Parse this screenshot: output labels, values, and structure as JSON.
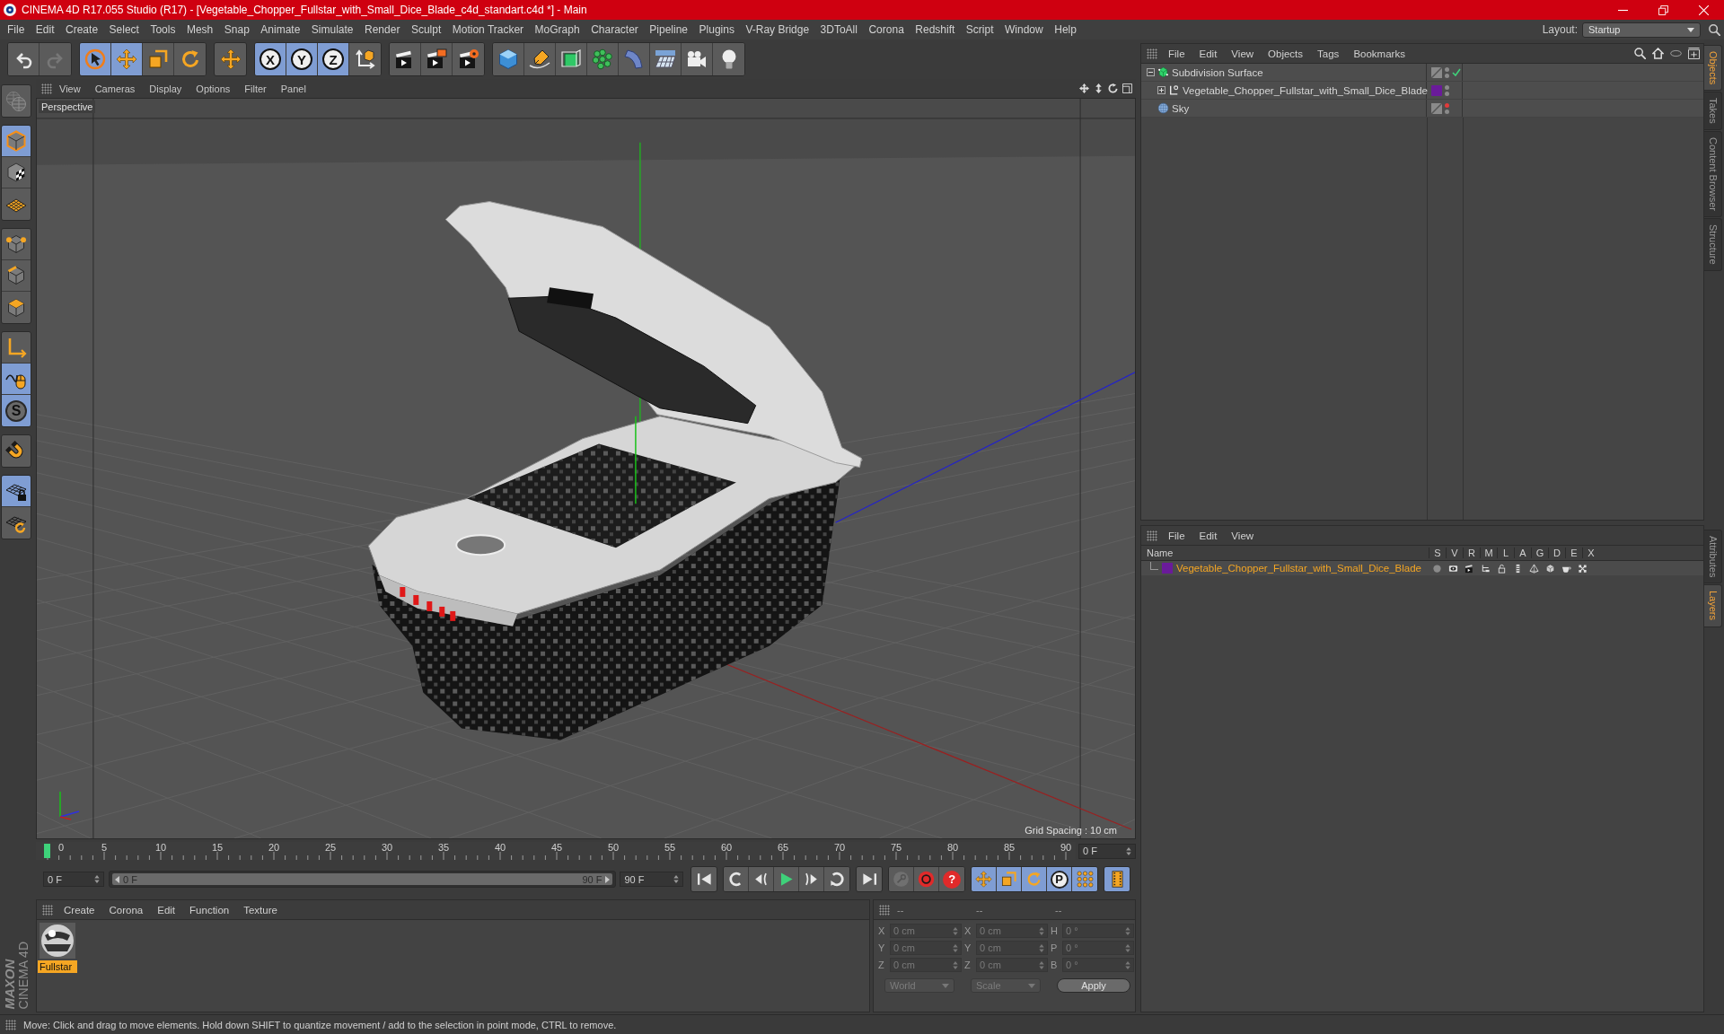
{
  "window": {
    "title": "CINEMA 4D R17.055 Studio (R17) - [Vegetable_Chopper_Fullstar_with_Small_Dice_Blade_c4d_standart.c4d *] - Main"
  },
  "menu_bar": [
    "File",
    "Edit",
    "Create",
    "Select",
    "Tools",
    "Mesh",
    "Snap",
    "Animate",
    "Simulate",
    "Render",
    "Sculpt",
    "Motion Tracker",
    "MoGraph",
    "Character",
    "Pipeline",
    "Plugins",
    "V-Ray Bridge",
    "3DToAll",
    "Corona",
    "Redshift",
    "Script",
    "Window",
    "Help"
  ],
  "layout": {
    "label": "Layout:",
    "value": "Startup"
  },
  "toolbar": [
    [
      {
        "kind": "undo",
        "active": false,
        "disabled": false
      },
      {
        "kind": "redo",
        "active": false,
        "disabled": true
      }
    ],
    [
      {
        "kind": "live-select",
        "active": true,
        "disabled": false
      },
      {
        "kind": "move",
        "active": true,
        "disabled": false
      },
      {
        "kind": "scale",
        "active": false,
        "disabled": false
      },
      {
        "kind": "rotate",
        "active": false,
        "disabled": false
      }
    ],
    [
      {
        "kind": "recent-tool",
        "active": false,
        "disabled": false
      }
    ],
    [
      {
        "kind": "axis-lock",
        "label": "X",
        "active": true,
        "disabled": false
      },
      {
        "kind": "axis-lock",
        "label": "Y",
        "active": true,
        "disabled": false
      },
      {
        "kind": "axis-lock",
        "label": "Z",
        "active": true,
        "disabled": false
      },
      {
        "kind": "coordinate-system",
        "active": false,
        "disabled": false
      }
    ],
    [
      {
        "kind": "render-view",
        "active": false,
        "disabled": false
      },
      {
        "kind": "render-picture",
        "active": false,
        "disabled": false
      },
      {
        "kind": "render-settings",
        "active": false,
        "disabled": false
      }
    ],
    [
      {
        "kind": "cube",
        "active": false,
        "disabled": false
      },
      {
        "kind": "pen",
        "active": false,
        "disabled": false
      },
      {
        "kind": "subdivision",
        "active": false,
        "disabled": false
      },
      {
        "kind": "cloner",
        "active": false,
        "disabled": false
      },
      {
        "kind": "deformer",
        "active": false,
        "disabled": false
      },
      {
        "kind": "floor",
        "active": false,
        "disabled": false
      },
      {
        "kind": "camera",
        "active": false,
        "disabled": false
      },
      {
        "kind": "light",
        "active": false,
        "disabled": false
      }
    ]
  ],
  "left_toolbar": [
    [
      {
        "kind": "make-editable",
        "active": false,
        "disabled": true
      }
    ],
    [
      {
        "kind": "model",
        "active": true,
        "disabled": false
      },
      {
        "kind": "texture",
        "active": false,
        "disabled": false
      },
      {
        "kind": "workplane",
        "active": false,
        "disabled": false
      }
    ],
    [
      {
        "kind": "points",
        "active": false,
        "disabled": false
      },
      {
        "kind": "edges",
        "active": false,
        "disabled": false
      },
      {
        "kind": "polygons",
        "active": false,
        "disabled": false
      }
    ],
    [
      {
        "kind": "axis",
        "active": false,
        "disabled": false
      },
      {
        "kind": "tweak",
        "active": true,
        "disabled": false
      },
      {
        "kind": "snap",
        "label": "S",
        "active": true,
        "disabled": false
      }
    ],
    [
      {
        "kind": "magnet",
        "active": false,
        "disabled": false
      }
    ],
    [
      {
        "kind": "workplane-lock",
        "active": true,
        "disabled": false
      },
      {
        "kind": "workplane-cycle",
        "active": false,
        "disabled": false
      }
    ]
  ],
  "logo": {
    "brand": "MAXON",
    "product": "CINEMA 4D"
  },
  "viewport": {
    "menu": [
      "View",
      "Cameras",
      "Display",
      "Options",
      "Filter",
      "Panel"
    ],
    "camera": "Perspective",
    "grid_spacing": "Grid Spacing : 10 cm"
  },
  "timeline": {
    "ticks": [
      "0",
      "5",
      "10",
      "15",
      "20",
      "25",
      "30",
      "35",
      "40",
      "45",
      "50",
      "55",
      "60",
      "65",
      "70",
      "75",
      "80",
      "85",
      "90"
    ],
    "playhead": {
      "level": 0
    },
    "current_frame": "0 F",
    "start": "0 F",
    "range": {
      "start": "0 F",
      "end": "90 F",
      "level": 1
    },
    "end": "90 F",
    "buttons": [
      [
        {
          "kind": "go-start",
          "active": false,
          "disabled": false
        }
      ],
      [
        {
          "kind": "previous-key",
          "active": false,
          "disabled": false
        },
        {
          "kind": "previous-frame",
          "active": false,
          "disabled": false
        },
        {
          "kind": "play",
          "active": false,
          "disabled": false
        },
        {
          "kind": "next-frame",
          "active": false,
          "disabled": false
        },
        {
          "kind": "next-key",
          "active": false,
          "disabled": false
        }
      ],
      [
        {
          "kind": "go-end",
          "active": false,
          "disabled": false
        }
      ],
      [
        {
          "kind": "keyframe",
          "active": false,
          "disabled": true
        },
        {
          "kind": "record",
          "active": false,
          "disabled": false
        },
        {
          "kind": "autokey",
          "label": "?",
          "active": false,
          "disabled": false
        }
      ],
      [
        {
          "kind": "key-position",
          "active": true,
          "disabled": false
        },
        {
          "kind": "key-scale",
          "active": true,
          "disabled": false
        },
        {
          "kind": "key-rotation",
          "active": true,
          "disabled": false
        },
        {
          "kind": "key-parameter",
          "label": "P",
          "active": true,
          "disabled": false
        },
        {
          "kind": "key-points",
          "active": true,
          "disabled": false
        }
      ],
      [
        {
          "kind": "timeline-window",
          "active": true,
          "disabled": false
        }
      ]
    ]
  },
  "material_manager": {
    "menu": [
      "Create",
      "Corona",
      "Edit",
      "Function",
      "Texture"
    ],
    "materials": [
      {
        "name": "Fullstar",
        "selected": true
      }
    ]
  },
  "coordinates": {
    "headers": [
      "--",
      "--",
      "--"
    ],
    "position": [
      {
        "axis": "X",
        "value": "0 cm"
      },
      {
        "axis": "Y",
        "value": "0 cm"
      },
      {
        "axis": "Z",
        "value": "0 cm"
      }
    ],
    "size": [
      {
        "axis": "X",
        "value": "0 cm"
      },
      {
        "axis": "Y",
        "value": "0 cm"
      },
      {
        "axis": "Z",
        "value": "0 cm"
      }
    ],
    "rotation": [
      {
        "axis": "H",
        "value": "0 °"
      },
      {
        "axis": "P",
        "value": "0 °"
      },
      {
        "axis": "B",
        "value": "0 °"
      }
    ],
    "coordinate_mode": "World",
    "size_mode": "Scale",
    "apply": "Apply"
  },
  "objects_panel": {
    "menu": [
      "File",
      "Edit",
      "View",
      "Objects",
      "Tags",
      "Bookmarks"
    ],
    "objects": [
      {
        "name": "Subdivision Surface",
        "kind": "generator",
        "expanded": true,
        "checked": true,
        "hidden_in_editor": false,
        "children": [
          {
            "name": "Vegetable_Chopper_Fullstar_with_Small_Dice_Blade",
            "kind": "null",
            "expanded": false,
            "checked": false,
            "hidden_in_editor": false,
            "color": "#6a1b9a"
          }
        ]
      },
      {
        "name": "Sky",
        "kind": "sky",
        "checked": false,
        "hidden_in_editor": true
      }
    ]
  },
  "layers_panel": {
    "menu": [
      "File",
      "Edit",
      "View"
    ],
    "columns": [
      "Name",
      "S",
      "V",
      "R",
      "M",
      "L",
      "A",
      "G",
      "D",
      "E",
      "X"
    ],
    "layers": [
      {
        "name": "Vegetable_Chopper_Fullstar_with_Small_Dice_Blade",
        "color": "#6a1b9a",
        "selected": true
      }
    ]
  },
  "side_tabs": {
    "top": [
      {
        "label": "Objects",
        "selected": true
      },
      {
        "label": "Takes",
        "selected": false
      },
      {
        "label": "Content Browser",
        "selected": false
      },
      {
        "label": "Structure",
        "selected": false
      }
    ],
    "bottom": [
      {
        "label": "Attributes",
        "selected": false
      },
      {
        "label": "Layers",
        "selected": true
      }
    ]
  },
  "status_bar": {
    "text": "Move: Click and drag to move elements. Hold down SHIFT to quantize movement / add to the selection in point mode, CTRL to remove."
  }
}
